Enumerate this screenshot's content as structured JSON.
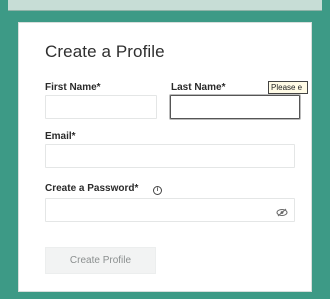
{
  "form": {
    "title": "Create a Profile",
    "first_name": {
      "label": "First Name*",
      "value": ""
    },
    "last_name": {
      "label": "Last Name*",
      "value": "",
      "tooltip": "Please e"
    },
    "email": {
      "label": "Email*",
      "value": ""
    },
    "password": {
      "label": "Create a Password*",
      "value": "",
      "info_icon": "info-icon",
      "toggle_icon": "eye-slash-icon"
    },
    "submit_label": "Create Profile"
  },
  "colors": {
    "frame": "#3d9a86",
    "card": "#ffffff",
    "button_disabled_bg": "#f2f3f3",
    "button_disabled_text": "#8b8f8f"
  }
}
